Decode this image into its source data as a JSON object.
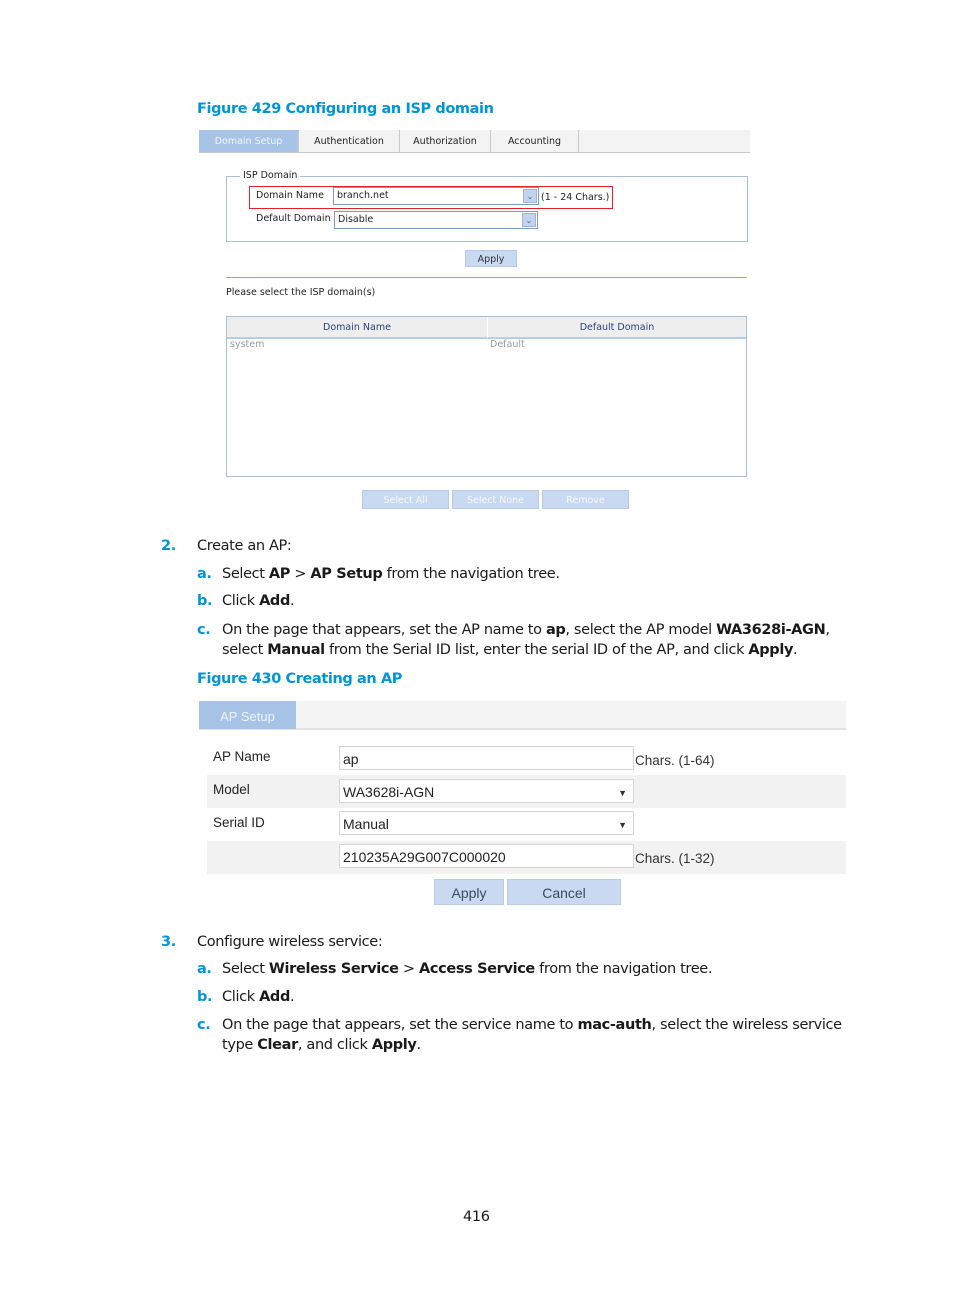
{
  "figure429": {
    "title": "Figure 429 Configuring an ISP domain",
    "tabs": [
      {
        "label": "Domain Setup",
        "active": true
      },
      {
        "label": "Authentication",
        "active": false
      },
      {
        "label": "Authorization",
        "active": false
      },
      {
        "label": "Accounting",
        "active": false
      }
    ],
    "fieldset_legend": "ISP Domain",
    "domain_name_label": "Domain Name",
    "domain_name_value": "branch.net",
    "domain_name_hint": "(1 - 24 Chars.)",
    "default_domain_label": "Default Domain",
    "default_domain_value": "Disable",
    "apply_label": "Apply",
    "select_prompt": "Please select the ISP domain(s)",
    "table": {
      "headers": [
        "Domain Name",
        "Default Domain"
      ],
      "rows": [
        [
          "system",
          "Default"
        ]
      ]
    },
    "buttons": {
      "select_all": "Select All",
      "select_none": "Select None",
      "remove": "Remove"
    }
  },
  "step2": {
    "num": "2.",
    "text": "Create an AP:",
    "items": [
      {
        "marker": "a.",
        "parts": [
          [
            "Select ",
            false
          ],
          [
            "AP",
            true
          ],
          [
            " > ",
            false
          ],
          [
            "AP Setup",
            true
          ],
          [
            " from the navigation tree.",
            false
          ]
        ]
      },
      {
        "marker": "b.",
        "parts": [
          [
            "Click ",
            false
          ],
          [
            "Add",
            true
          ],
          [
            ".",
            false
          ]
        ]
      },
      {
        "marker": "c.",
        "parts": [
          [
            "On the page that appears, set the AP name to ",
            false
          ],
          [
            "ap",
            true
          ],
          [
            ", select the AP model ",
            false
          ],
          [
            "WA3628i-AGN",
            true
          ],
          [
            ", select ",
            false
          ],
          [
            "Manual",
            true
          ],
          [
            " from the Serial ID list, enter the serial ID of the AP, and click ",
            false
          ],
          [
            "Apply",
            true
          ],
          [
            ".",
            false
          ]
        ]
      }
    ]
  },
  "figure430": {
    "title": "Figure 430 Creating an AP",
    "tab": "AP Setup",
    "ap_name_label": "AP Name",
    "ap_name_value": "ap",
    "ap_name_hint": "Chars. (1-64)",
    "model_label": "Model",
    "model_value": "WA3628i-AGN",
    "serial_label": "Serial ID",
    "serial_mode": "Manual",
    "serial_value": "210235A29G007C000020",
    "serial_hint": "Chars. (1-32)",
    "apply_label": "Apply",
    "cancel_label": "Cancel"
  },
  "step3": {
    "num": "3.",
    "text": "Configure wireless service:",
    "items": [
      {
        "marker": "a.",
        "parts": [
          [
            "Select ",
            false
          ],
          [
            "Wireless Service",
            true
          ],
          [
            " > ",
            false
          ],
          [
            "Access Service",
            true
          ],
          [
            " from the navigation tree.",
            false
          ]
        ]
      },
      {
        "marker": "b.",
        "parts": [
          [
            "Click ",
            false
          ],
          [
            "Add",
            true
          ],
          [
            ".",
            false
          ]
        ]
      },
      {
        "marker": "c.",
        "parts": [
          [
            "On the page that appears, set the service name to ",
            false
          ],
          [
            "mac-auth",
            true
          ],
          [
            ", select the wireless service type ",
            false
          ],
          [
            "Clear",
            true
          ],
          [
            ", and click ",
            false
          ],
          [
            "Apply",
            true
          ],
          [
            ".",
            false
          ]
        ]
      }
    ]
  },
  "page_number": "416"
}
